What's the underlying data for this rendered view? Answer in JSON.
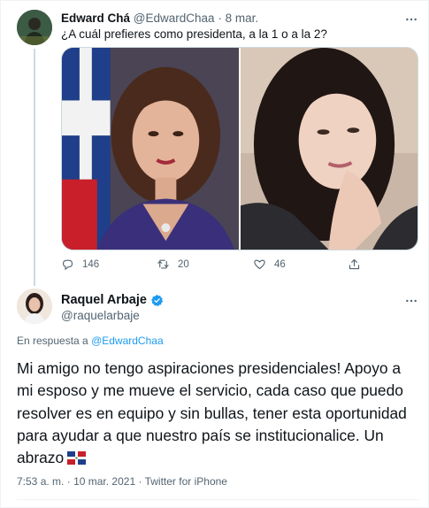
{
  "parent_tweet": {
    "name": "Edward Chá",
    "handle": "@EdwardChaa",
    "separator": "·",
    "date": "8 mar.",
    "text": "¿A cuál prefieres como presidenta, a la 1 o a la 2?",
    "counts": {
      "replies": "146",
      "retweets": "20",
      "likes": "46"
    }
  },
  "reply_tweet": {
    "name": "Raquel Arbaje",
    "handle": "@raquelarbaje",
    "replying_prefix": "En respuesta a",
    "replying_to": "@EdwardChaa",
    "text": "Mi amigo no tengo aspiraciones presidenciales! Apoyo a mi esposo y me mueve el servicio, cada caso que puedo resolver es en equipo y sin bullas, tener esta oportunidad para ayudar a que nuestro país se institucionalice. Un abrazo",
    "flag": "dominican-republic-flag-icon",
    "time": "7:53 a. m.",
    "date": "10 mar. 2021",
    "source": "Twitter for iPhone",
    "meta_separator": "·"
  },
  "colors": {
    "accent": "#1d9bf0",
    "muted": "#536471",
    "text": "#0f1419",
    "border": "#eff3f4"
  },
  "icons": [
    "more-icon",
    "reply-icon",
    "retweet-icon",
    "like-icon",
    "share-icon",
    "verified-icon"
  ]
}
